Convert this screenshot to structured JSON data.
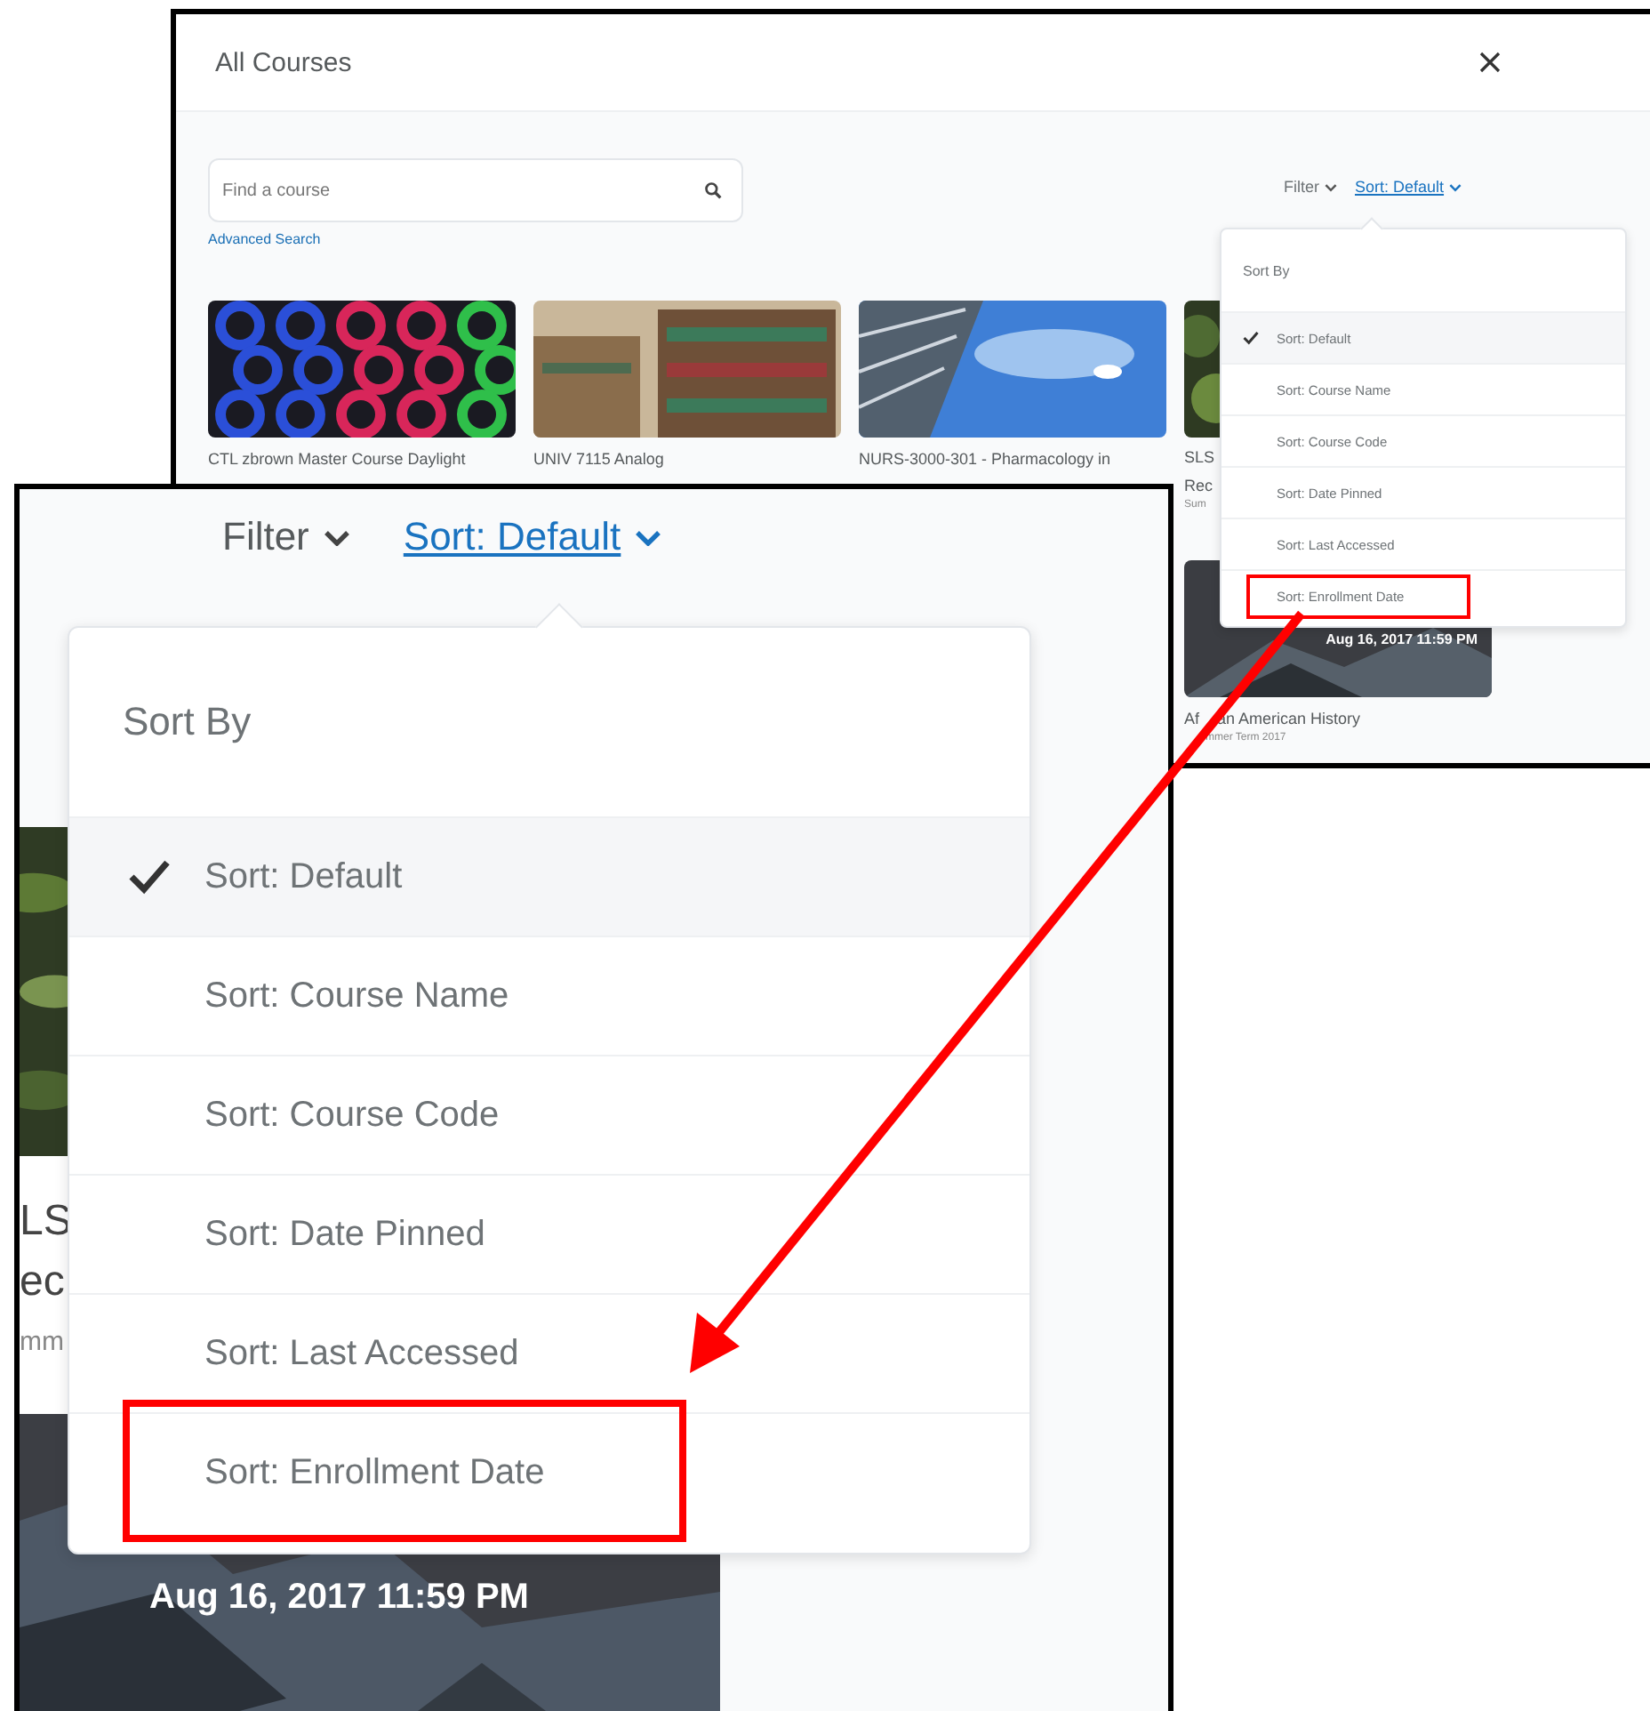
{
  "back_window": {
    "title": "All Courses",
    "search": {
      "placeholder": "Find a course"
    },
    "advanced_search": "Advanced Search",
    "filter": "Filter",
    "sort": "Sort: Default",
    "courses": [
      {
        "title": "CTL zbrown Master Course Daylight"
      },
      {
        "title": "UNIV 7115 Analog"
      },
      {
        "title": "NURS-3000-301 - Pharmacology in"
      }
    ],
    "partial_course": {
      "lines": [
        "SLS",
        "Rec"
      ],
      "note": "Sum"
    },
    "next_course": {
      "date": "Aug 16, 2017 11:59 PM",
      "title_parts": [
        "Af",
        "an American History"
      ],
      "term": "mmer Term 2017"
    },
    "menu": {
      "heading": "Sort By",
      "items": [
        {
          "label": "Sort: Default",
          "selected": true,
          "highlighted": false
        },
        {
          "label": "Sort: Course Name",
          "selected": false,
          "highlighted": false
        },
        {
          "label": "Sort: Course Code",
          "selected": false,
          "highlighted": false
        },
        {
          "label": "Sort: Date Pinned",
          "selected": false,
          "highlighted": false
        },
        {
          "label": "Sort: Last Accessed",
          "selected": false,
          "highlighted": false
        },
        {
          "label": "Sort: Enrollment Date",
          "selected": false,
          "highlighted": true
        }
      ]
    }
  },
  "zoom_panel": {
    "filter": "Filter",
    "sort": "Sort: Default",
    "partial_course": {
      "lines": [
        "LS",
        "ec"
      ],
      "note": "mm",
      "date": "Aug 16, 2017 11:59 PM"
    },
    "menu": {
      "heading": "Sort By",
      "items": [
        {
          "label": "Sort: Default",
          "selected": true,
          "highlighted": false
        },
        {
          "label": "Sort: Course Name",
          "selected": false,
          "highlighted": false
        },
        {
          "label": "Sort: Course Code",
          "selected": false,
          "highlighted": false
        },
        {
          "label": "Sort: Date Pinned",
          "selected": false,
          "highlighted": false
        },
        {
          "label": "Sort: Last Accessed",
          "selected": false,
          "highlighted": false
        },
        {
          "label": "Sort: Enrollment Date",
          "selected": false,
          "highlighted": true
        }
      ]
    }
  }
}
